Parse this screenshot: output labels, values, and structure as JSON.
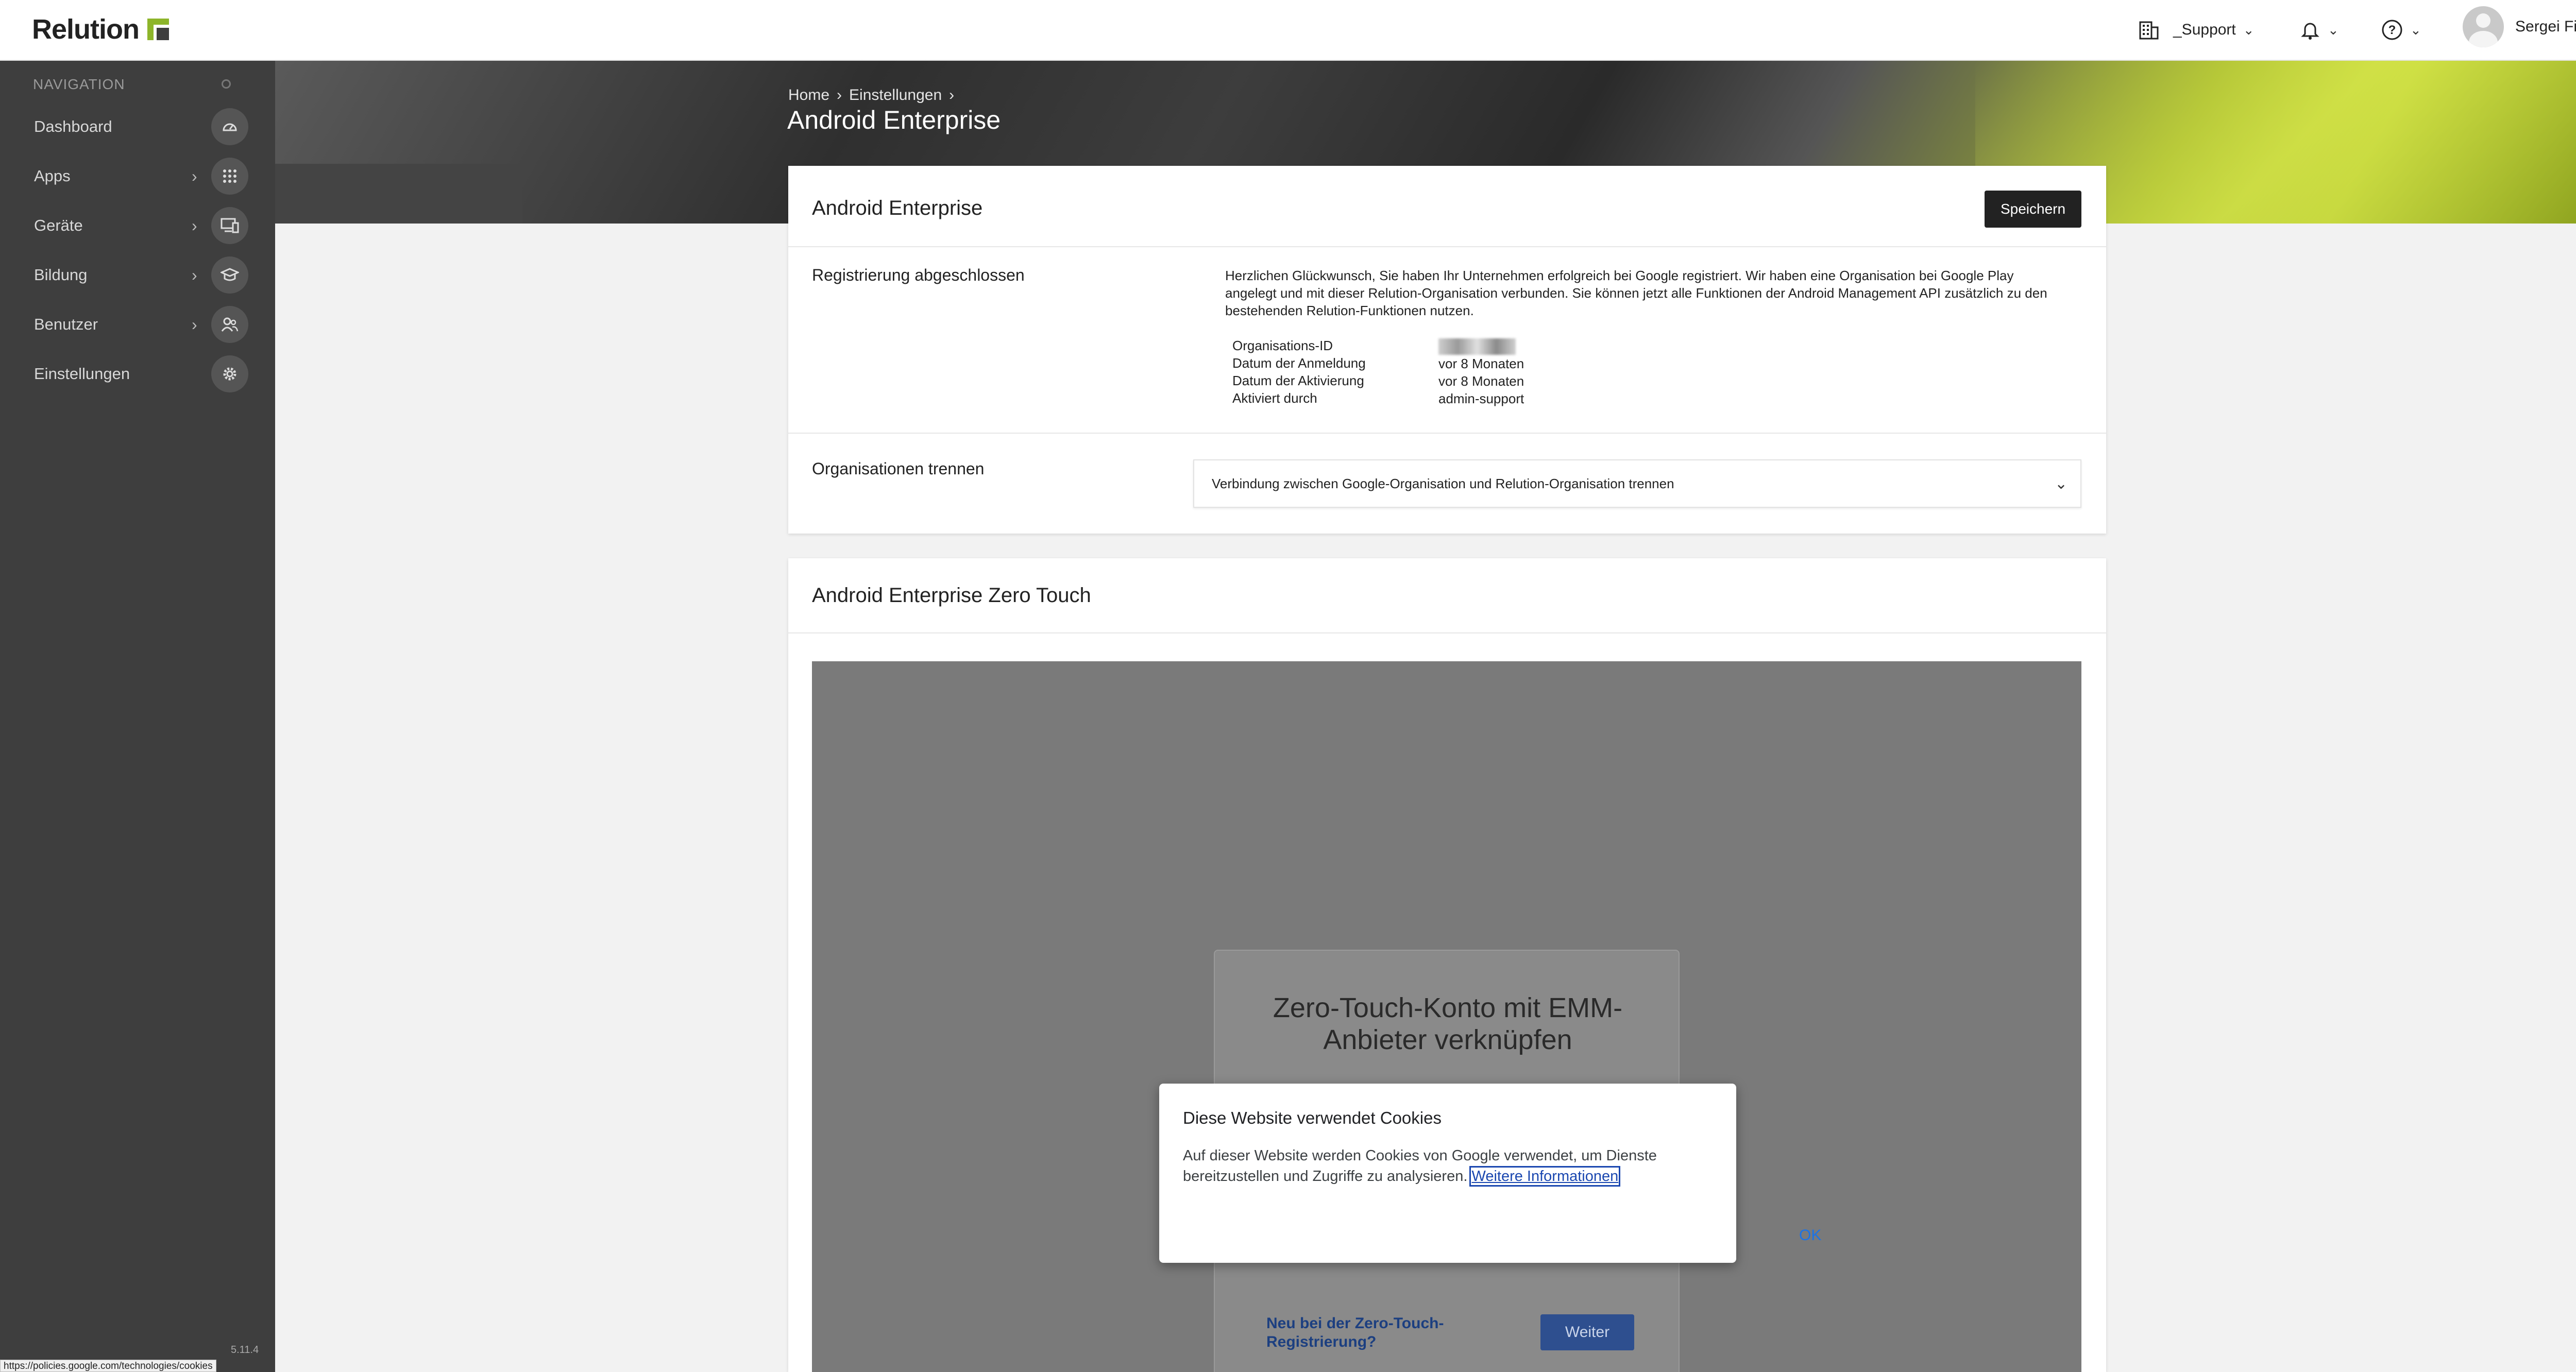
{
  "topbar": {
    "logo": "Relution",
    "org": "_Support",
    "user": "Sergei Fink"
  },
  "sidebar": {
    "heading": "NAVIGATION",
    "items": [
      {
        "label": "Dashboard",
        "icon": "dashboard-icon",
        "has_arrow": false
      },
      {
        "label": "Apps",
        "icon": "apps-grid-icon",
        "has_arrow": true
      },
      {
        "label": "Geräte",
        "icon": "devices-icon",
        "has_arrow": true
      },
      {
        "label": "Bildung",
        "icon": "education-icon",
        "has_arrow": true
      },
      {
        "label": "Benutzer",
        "icon": "users-icon",
        "has_arrow": true
      },
      {
        "label": "Einstellungen",
        "icon": "settings-gear-icon",
        "has_arrow": false
      }
    ],
    "version": "5.11.4"
  },
  "status_url": "https://policies.google.com/technologies/cookies",
  "header": {
    "breadcrumb": [
      "Home",
      "Einstellungen"
    ],
    "title": "Android Enterprise"
  },
  "android_enterprise": {
    "title": "Android Enterprise",
    "save_label": "Speichern",
    "registration_label": "Registrierung abgeschlossen",
    "registration_text": "Herzlichen Glückwunsch, Sie haben Ihr Unternehmen erfolgreich bei Google registriert. Wir haben eine Organisation bei Google Play angelegt und mit dieser Relution-Organisation verbunden. Sie können jetzt alle Funktionen der Android Management API zusätzlich zu den bestehenden Relution-Funktionen nutzen.",
    "details": [
      {
        "key": "Organisations-ID",
        "value": ""
      },
      {
        "key": "Datum der Anmeldung",
        "value": "vor 8 Monaten"
      },
      {
        "key": "Datum der Aktivierung",
        "value": "vor 8 Monaten"
      },
      {
        "key": "Aktiviert durch",
        "value": "admin-support"
      }
    ],
    "disconnect_label": "Organisationen trennen",
    "disconnect_accordion": "Verbindung zwischen Google-Organisation und Relution-Organisation trennen"
  },
  "zero_touch": {
    "title": "Android Enterprise Zero Touch",
    "embed_title": "Zero-Touch-Konto mit EMM-Anbieter verknüpfen",
    "new_link": "Neu bei der Zero-Touch-Registrierung?",
    "next_label": "Weiter"
  },
  "cookie_dialog": {
    "title": "Diese Website verwendet Cookies",
    "text": "Auf dieser Website werden Cookies von Google verwendet, um Dienste bereitzustellen und Zugriffe zu analysieren.",
    "link": "Weitere Informationen",
    "ok": "OK"
  }
}
